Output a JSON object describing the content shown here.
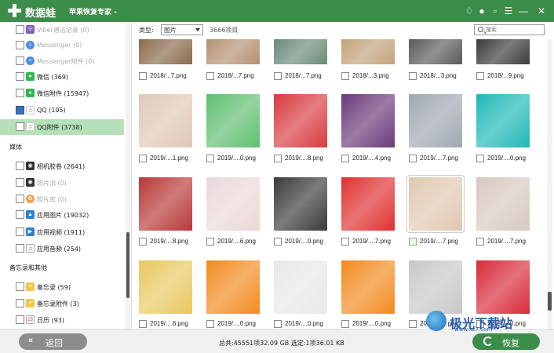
{
  "title_bar": {
    "app_name": "数据蛙",
    "subtitle": "苹果恢复专家 -",
    "icons": [
      "diamond-icon",
      "chat-icon",
      "feedback-icon",
      "menu-icon",
      "minimize-icon",
      "close-icon"
    ],
    "brand_color": "#3d8d4a"
  },
  "sidebar": {
    "items": [
      {
        "label": "Viber通话记录 (0)",
        "checked": false,
        "icon": "viber-icon",
        "dim": true
      },
      {
        "label": "Messenger (0)",
        "checked": false,
        "icon": "messenger-icon",
        "dim": true
      },
      {
        "label": "Messenger附件 (0)",
        "checked": false,
        "icon": "messenger-icon",
        "dim": true
      },
      {
        "label": "微信 (369)",
        "checked": false,
        "icon": "wechat-icon",
        "dim": false
      },
      {
        "label": "微信附件 (15947)",
        "checked": false,
        "icon": "wechat-icon",
        "dim": false
      },
      {
        "label": "QQ (105)",
        "checked": true,
        "icon": "qq-icon",
        "dim": false
      },
      {
        "label": "QQ附件 (3738)",
        "checked": false,
        "icon": "qq-icon",
        "dim": false,
        "active": true
      }
    ],
    "section_media": "媒体",
    "media_items": [
      {
        "label": "相机胶卷 (2641)",
        "icon": "camera-icon",
        "dim": false
      },
      {
        "label": "照片流 (0)",
        "icon": "camera-icon",
        "dim": true
      },
      {
        "label": "照片库 (0)",
        "icon": "photos-icon",
        "dim": true
      },
      {
        "label": "应用图片 (19032)",
        "icon": "image-icon",
        "dim": false
      },
      {
        "label": "应用视频 (1911)",
        "icon": "video-icon",
        "dim": false
      },
      {
        "label": "应用音频 (254)",
        "icon": "music-icon",
        "dim": false
      }
    ],
    "section_notes": "备忘录和其他",
    "notes_items": [
      {
        "label": "备忘录 (59)",
        "icon": "notes-icon",
        "dim": false
      },
      {
        "label": "备忘录附件 (3)",
        "icon": "notes-icon",
        "dim": false
      },
      {
        "label": "日历 (93)",
        "icon": "calendar-icon",
        "dim": false
      }
    ]
  },
  "toolbar": {
    "type_label": "类型:",
    "type_value": "图片",
    "count": "3666项目",
    "search_placeholder": "搜索"
  },
  "grid": {
    "rows": [
      [
        "2018/...7.png",
        "2018/...7.png",
        "2018/...7.png",
        "2018/...3.png",
        "2018/...3.png",
        "2018/...9.png"
      ],
      [
        "2019/....1.png",
        "2019/....0.png",
        "2019/....8.png",
        "2019/....4.png",
        "2019/....7.png",
        "2019/....0.png"
      ],
      [
        "2019/....8.png",
        "2019/....6.png",
        "2019/....0.png",
        "2019/....7.png",
        "2019/....7.png",
        "2019/....7.png"
      ],
      [
        "2019/....6.png",
        "2019/....0.png",
        "2019/....0.png",
        "2019/....0.png",
        "2019/....0.png",
        "2019/....0.png"
      ]
    ],
    "tile_colors": [
      [
        "#8a6a4a",
        "#b49070",
        "#6a8a7a",
        "#c4a27a",
        "#5a5a5a",
        "#3a3a3a"
      ],
      [
        "#e0c8b8",
        "#5fbf6f",
        "#d83b40",
        "#6a3a7a",
        "#a0a8b0",
        "#20b8b8"
      ],
      [
        "#b83838",
        "#ecd8d8",
        "#3a3a3a",
        "#e03030",
        "#e0c8b0",
        "#d8c8c0"
      ],
      [
        "#e8c860",
        "#f28a1e",
        "#e8e8e8",
        "#f28a1e",
        "#c8c8c8",
        "#d82a3a"
      ]
    ]
  },
  "footer": {
    "back_label": "返回",
    "stats": "总共:45551项32.09 GB 选定:1项36.01 KB",
    "recover_label": "恢复"
  },
  "watermark": {
    "text": "极光下载站",
    "url": "www.xz7.com"
  }
}
